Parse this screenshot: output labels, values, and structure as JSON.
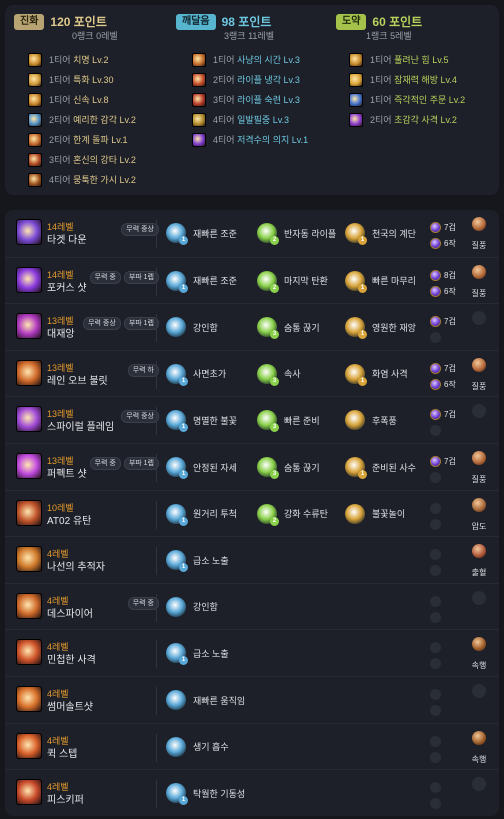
{
  "engraving_summary": [
    {
      "badge": "진화",
      "points": "120 포인트",
      "rank": "0랭크 0레벨",
      "badge_color": "#b8a472",
      "items": [
        {
          "tier": "1티어",
          "name": "치명 Lv.2",
          "icon_color": "#c98a2a"
        },
        {
          "tier": "1티어",
          "name": "특화 Lv.30",
          "icon_color": "#d19a3a"
        },
        {
          "tier": "1티어",
          "name": "신속 Lv.8",
          "icon_color": "#c9842b"
        },
        {
          "tier": "2티어",
          "name": "예리한 감각 Lv.2",
          "icon_color": "#4d8fc7"
        },
        {
          "tier": "2티어",
          "name": "한계 돌파 Lv.1",
          "icon_color": "#c2692b"
        },
        {
          "tier": "3티어",
          "name": "혼신의 강타 Lv.2",
          "icon_color": "#b24a24"
        },
        {
          "tier": "4티어",
          "name": "뭉툭한 가시 Lv.2",
          "icon_color": "#a0521f"
        }
      ]
    },
    {
      "badge": "깨달음",
      "points": "98 포인트",
      "rank": "3랭크 11레벨",
      "badge_color": "#58b5cf",
      "items": [
        {
          "tier": "1티어",
          "name": "사냥의 시간 Lv.3",
          "icon_color": "#c46c2a"
        },
        {
          "tier": "2티어",
          "name": "라이플 냉각 Lv.3",
          "icon_color": "#c44a2a"
        },
        {
          "tier": "3티어",
          "name": "라이플 숙련 Lv.3",
          "icon_color": "#b5382a"
        },
        {
          "tier": "4티어",
          "name": "일발필중 Lv.3",
          "icon_color": "#b08a2a"
        },
        {
          "tier": "4티어",
          "name": "저격수의 의지 Lv.1",
          "icon_color": "#7a3ad0"
        }
      ]
    },
    {
      "badge": "도약",
      "points": "60 포인트",
      "rank": "1랭크 5레벨",
      "badge_color": "#a5c24b",
      "items": [
        {
          "tier": "1티어",
          "name": "풀려난 힘 Lv.5",
          "icon_color": "#c98a2a"
        },
        {
          "tier": "1티어",
          "name": "잠재력 해방 Lv.4",
          "icon_color": "#d9a235"
        },
        {
          "tier": "1티어",
          "name": "즉각적인 주문 Lv.2",
          "icon_color": "#3d6fd0"
        },
        {
          "tier": "2티어",
          "name": "초감각 사격 Lv.2",
          "icon_color": "#8a3ad0"
        }
      ]
    }
  ],
  "skills": [
    {
      "level": "14레벨",
      "name": "타겟 다운",
      "tags": [
        "무력 중상"
      ],
      "icon_color": "#7b4ad8",
      "tripods": [
        {
          "name": "재빠른 조준",
          "c": "#5aa8d8",
          "n": "1"
        },
        {
          "name": "반자동 라이플",
          "c": "#8ad04a",
          "n": "2"
        },
        {
          "name": "천국의 계단",
          "c": "#d8a43a",
          "n": "1"
        }
      ],
      "gems": [
        "7겁",
        "6작"
      ],
      "rune": "질풍",
      "rune_color": "#b46a3a"
    },
    {
      "level": "14레벨",
      "name": "포커스 샷",
      "tags": [
        "무력 중",
        "부파 1렙"
      ],
      "icon_color": "#8a3ae0",
      "tripods": [
        {
          "name": "재빠른 조준",
          "c": "#5aa8d8",
          "n": "1"
        },
        {
          "name": "마지막 탄환",
          "c": "#8ad04a",
          "n": "2"
        },
        {
          "name": "빠른 마무리",
          "c": "#d8a43a",
          "n": "1"
        }
      ],
      "gems": [
        "8겁",
        "6작"
      ],
      "rune": "질풍",
      "rune_color": "#b46a3a"
    },
    {
      "level": "13레벨",
      "name": "대재앙",
      "tags": [
        "무력 중상",
        "부파 1렙"
      ],
      "icon_color": "#b03ac0",
      "tripods": [
        {
          "name": "강인함",
          "c": "#5aa8d8",
          "n": ""
        },
        {
          "name": "숨통 끊기",
          "c": "#8ad04a",
          "n": "3"
        },
        {
          "name": "영원한 재앙",
          "c": "#d8a43a",
          "n": "1"
        }
      ],
      "gems": [
        "7겁",
        ""
      ],
      "rune": "",
      "rune_color": ""
    },
    {
      "level": "13레벨",
      "name": "레인 오브 불릿",
      "tags": [
        "무력 하"
      ],
      "icon_color": "#d06a2a",
      "tripods": [
        {
          "name": "사면초가",
          "c": "#5aa8d8",
          "n": "1"
        },
        {
          "name": "속사",
          "c": "#8ad04a",
          "n": "3"
        },
        {
          "name": "화염 사격",
          "c": "#d8a43a",
          "n": "1"
        }
      ],
      "gems": [
        "7겁",
        "6작"
      ],
      "rune": "질풍",
      "rune_color": "#b46a3a"
    },
    {
      "level": "13레벨",
      "name": "스파이럴 플레임",
      "tags": [
        "무력 중상"
      ],
      "icon_color": "#a04ad8",
      "tripods": [
        {
          "name": "명멸한 불꽃",
          "c": "#5aa8d8",
          "n": "1"
        },
        {
          "name": "빠른 준비",
          "c": "#8ad04a",
          "n": "3"
        },
        {
          "name": "후폭풍",
          "c": "#d8a43a",
          "n": ""
        }
      ],
      "gems": [
        "7겁",
        ""
      ],
      "rune": "",
      "rune_color": ""
    },
    {
      "level": "13레벨",
      "name": "퍼펙트 샷",
      "tags": [
        "무력 중",
        "부파 1렙"
      ],
      "icon_color": "#c04ae0",
      "tripods": [
        {
          "name": "안정된 자세",
          "c": "#5aa8d8",
          "n": "1"
        },
        {
          "name": "숨통 끊기",
          "c": "#8ad04a",
          "n": "3"
        },
        {
          "name": "준비된 사수",
          "c": "#d8a43a",
          "n": "1"
        }
      ],
      "gems": [
        "7겁",
        ""
      ],
      "rune": "질풍",
      "rune_color": "#b46a3a"
    },
    {
      "level": "10레벨",
      "name": "AT02 유탄",
      "tags": [],
      "icon_color": "#c0542a",
      "tripods": [
        {
          "name": "원거리 투척",
          "c": "#5aa8d8",
          "n": "1"
        },
        {
          "name": "강화 수류탄",
          "c": "#8ad04a",
          "n": "2"
        },
        {
          "name": "불꽃놀이",
          "c": "#d8a43a",
          "n": ""
        }
      ],
      "gems": [
        "",
        ""
      ],
      "rune": "압도",
      "rune_color": "#a86a3a"
    },
    {
      "level": "4레벨",
      "name": "나선의 추적자",
      "tags": [],
      "icon_color": "#d07a2a",
      "tripods": [
        {
          "name": "급소 노출",
          "c": "#5aa8d8",
          "n": "1"
        },
        {
          "name": "",
          "c": "",
          "n": ""
        },
        {
          "name": "",
          "c": "",
          "n": ""
        }
      ],
      "gems": [
        "",
        ""
      ],
      "rune": "출혈",
      "rune_color": "#b05a3a"
    },
    {
      "level": "4레벨",
      "name": "데스파이어",
      "tags": [
        "무력 중"
      ],
      "icon_color": "#d06a2a",
      "tripods": [
        {
          "name": "강인함",
          "c": "#5aa8d8",
          "n": ""
        },
        {
          "name": "",
          "c": "",
          "n": ""
        },
        {
          "name": "",
          "c": "",
          "n": ""
        }
      ],
      "gems": [
        "",
        ""
      ],
      "rune": "",
      "rune_color": ""
    },
    {
      "level": "4레벨",
      "name": "민첩한 사격",
      "tags": [],
      "icon_color": "#d0542a",
      "tripods": [
        {
          "name": "급소 노출",
          "c": "#5aa8d8",
          "n": "1"
        },
        {
          "name": "",
          "c": "",
          "n": ""
        },
        {
          "name": "",
          "c": "",
          "n": ""
        }
      ],
      "gems": [
        "",
        ""
      ],
      "rune": "속행",
      "rune_color": "#a0602a"
    },
    {
      "level": "4레벨",
      "name": "썸머솔트샷",
      "tags": [],
      "icon_color": "#d8702a",
      "tripods": [
        {
          "name": "재빠른 움직임",
          "c": "#5aa8d8",
          "n": ""
        },
        {
          "name": "",
          "c": "",
          "n": ""
        },
        {
          "name": "",
          "c": "",
          "n": ""
        }
      ],
      "gems": [
        "",
        ""
      ],
      "rune": "",
      "rune_color": ""
    },
    {
      "level": "4레벨",
      "name": "퀵 스텝",
      "tags": [],
      "icon_color": "#d8602a",
      "tripods": [
        {
          "name": "생기 흡수",
          "c": "#5aa8d8",
          "n": ""
        },
        {
          "name": "",
          "c": "",
          "n": ""
        },
        {
          "name": "",
          "c": "",
          "n": ""
        }
      ],
      "gems": [
        "",
        ""
      ],
      "rune": "속행",
      "rune_color": "#a0602a"
    },
    {
      "level": "4레벨",
      "name": "피스키퍼",
      "tags": [],
      "icon_color": "#c84a2a",
      "tripods": [
        {
          "name": "탁월한 기동성",
          "c": "#5aa8d8",
          "n": "1"
        },
        {
          "name": "",
          "c": "",
          "n": ""
        },
        {
          "name": "",
          "c": "",
          "n": ""
        }
      ],
      "gems": [
        "",
        ""
      ],
      "rune": "",
      "rune_color": ""
    }
  ]
}
